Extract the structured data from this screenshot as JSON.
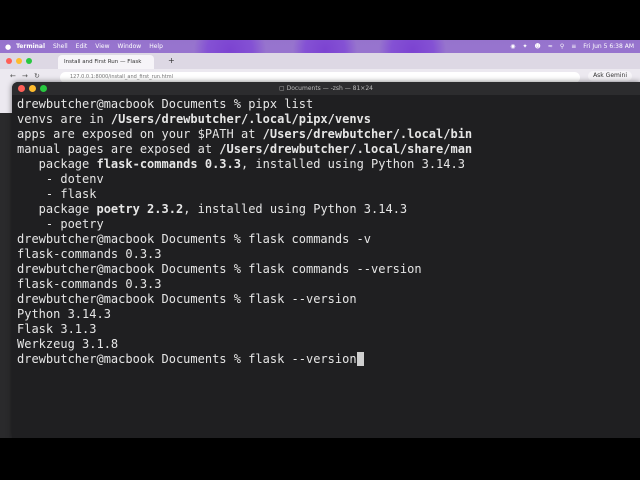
{
  "menubar": {
    "app": "Terminal",
    "items": [
      "Shell",
      "Edit",
      "View",
      "Window",
      "Help"
    ],
    "datetime": "Fri Jun 5  6:38 AM"
  },
  "browser": {
    "tab_label": "Install and First Run — Flask",
    "address": "127.0.0.1:8000/install_and_first_run.html",
    "gemini": "Ask Gemini"
  },
  "terminal": {
    "title": "Documents — -zsh — 81×24",
    "lines": [
      [
        {
          "t": "drewbutcher@macbook Documents % pipx list"
        }
      ],
      [
        {
          "t": "venvs are in "
        },
        {
          "t": "/Users/drewbutcher/.local/pipx/venvs",
          "b": true
        }
      ],
      [
        {
          "t": "apps are exposed on your $PATH at "
        },
        {
          "t": "/Users/drewbutcher/.local/bin",
          "b": true
        }
      ],
      [
        {
          "t": "manual pages are exposed at "
        },
        {
          "t": "/Users/drewbutcher/.local/share/man",
          "b": true
        }
      ],
      [
        {
          "t": "   package "
        },
        {
          "t": "flask-commands 0.3.3",
          "b": true
        },
        {
          "t": ", installed using Python 3.14.3"
        }
      ],
      [
        {
          "t": "    - dotenv"
        }
      ],
      [
        {
          "t": "    - flask"
        }
      ],
      [
        {
          "t": "   package "
        },
        {
          "t": "poetry 2.3.2",
          "b": true
        },
        {
          "t": ", installed using Python 3.14.3"
        }
      ],
      [
        {
          "t": "    - poetry"
        }
      ],
      [
        {
          "t": "drewbutcher@macbook Documents % flask commands -v"
        }
      ],
      [
        {
          "t": "flask-commands 0.3.3"
        }
      ],
      [
        {
          "t": "drewbutcher@macbook Documents % flask commands --version"
        }
      ],
      [
        {
          "t": "flask-commands 0.3.3"
        }
      ],
      [
        {
          "t": "drewbutcher@macbook Documents % flask --version"
        }
      ],
      [
        {
          "t": "Python 3.14.3"
        }
      ],
      [
        {
          "t": "Flask 3.1.3"
        }
      ],
      [
        {
          "t": "Werkzeug 3.1.8"
        }
      ],
      [
        {
          "t": "drewbutcher@macbook Documents % flask --version"
        }
      ]
    ]
  },
  "colors": {
    "terminal_bg": "#1f1f21",
    "terminal_text": "#e6e6e6",
    "desktop_accent": "#7a2fe0"
  }
}
